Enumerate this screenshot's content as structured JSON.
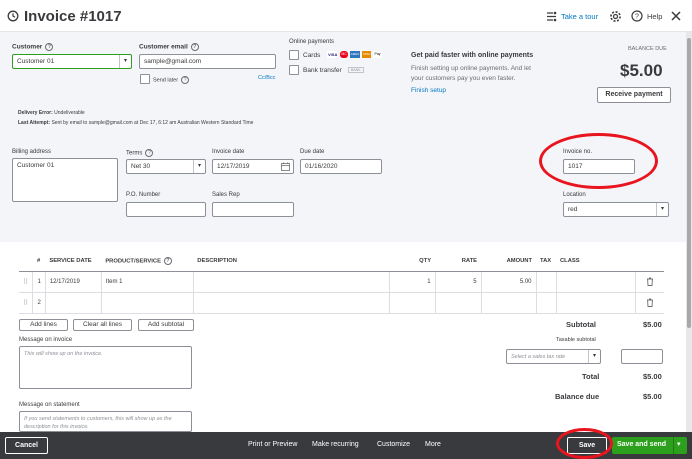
{
  "header": {
    "title": "Invoice #1017",
    "take_tour": "Take a tour",
    "help": "Help"
  },
  "customer": {
    "label": "Customer",
    "value": "Customer 01"
  },
  "email": {
    "label": "Customer email",
    "value": "sample@gmail.com",
    "send_later": "Send later",
    "cc_bcc": "Cc/Bcc"
  },
  "online_payments": {
    "label": "Online payments",
    "cards": "Cards",
    "card_logos": [
      "VISA",
      "MC",
      "AMEX",
      "DISC",
      "Pay"
    ],
    "bank_transfer": "Bank transfer",
    "bank_badge": "BANK",
    "promo_title": "Get paid faster with online payments",
    "promo_text": "Finish setting up online payments. And let your customers pay you even faster.",
    "finish_setup": "Finish setup"
  },
  "balance": {
    "label": "BALANCE DUE",
    "amount": "$5.00",
    "receive_payment": "Receive payment"
  },
  "delivery": {
    "error_label": "Delivery Error:",
    "error_value": "Undeliverable",
    "last_attempt_label": "Last Attempt:",
    "last_attempt_value": "Sent by email to sample@gmail.com at Dec 17, 6:12 am Australian Western Standard Time"
  },
  "billing": {
    "label": "Billing address",
    "value": "Customer 01"
  },
  "terms": {
    "label": "Terms",
    "value": "Net 30"
  },
  "invoice_date": {
    "label": "Invoice date",
    "value": "12/17/2019"
  },
  "due_date": {
    "label": "Due date",
    "value": "01/16/2020"
  },
  "invoice_no": {
    "label": "Invoice no.",
    "value": "1017"
  },
  "po_number": {
    "label": "P.O. Number",
    "value": ""
  },
  "sales_rep": {
    "label": "Sales Rep",
    "value": ""
  },
  "location": {
    "label": "Location",
    "value": "red"
  },
  "table": {
    "headers": [
      "#",
      "SERVICE DATE",
      "PRODUCT/SERVICE",
      "DESCRIPTION",
      "QTY",
      "RATE",
      "AMOUNT",
      "TAX",
      "CLASS"
    ],
    "rows": [
      {
        "num": "1",
        "date": "12/17/2019",
        "product": "Item 1",
        "description": "",
        "qty": "1",
        "rate": "5",
        "amount": "5.00",
        "tax": "",
        "class": ""
      },
      {
        "num": "2",
        "date": "",
        "product": "",
        "description": "",
        "qty": "",
        "rate": "",
        "amount": "",
        "tax": "",
        "class": ""
      }
    ]
  },
  "line_buttons": {
    "add_lines": "Add lines",
    "clear_all": "Clear all lines",
    "add_subtotal": "Add subtotal"
  },
  "message_invoice": {
    "label": "Message on invoice",
    "placeholder": "This will show up on the invoice."
  },
  "message_statement": {
    "label": "Message on statement",
    "placeholder": "If you send statements to customers, this will show up as the description for this invoice."
  },
  "totals": {
    "subtotal_label": "Subtotal",
    "subtotal_value": "$5.00",
    "taxable_subtotal": "Taxable subtotal",
    "tax_rate_placeholder": "Select a sales tax rate",
    "total_label": "Total",
    "total_value": "$5.00",
    "balance_due_label": "Balance due",
    "balance_due_value": "$5.00"
  },
  "footer": {
    "cancel": "Cancel",
    "print_preview": "Print or Preview",
    "make_recurring": "Make recurring",
    "customize": "Customize",
    "more": "More",
    "save": "Save",
    "save_and_send": "Save and send"
  },
  "colors": {
    "green": "#2ca01c",
    "link": "#0077c5",
    "footer_bg": "#393a3d",
    "highlight": "#e8141e"
  }
}
